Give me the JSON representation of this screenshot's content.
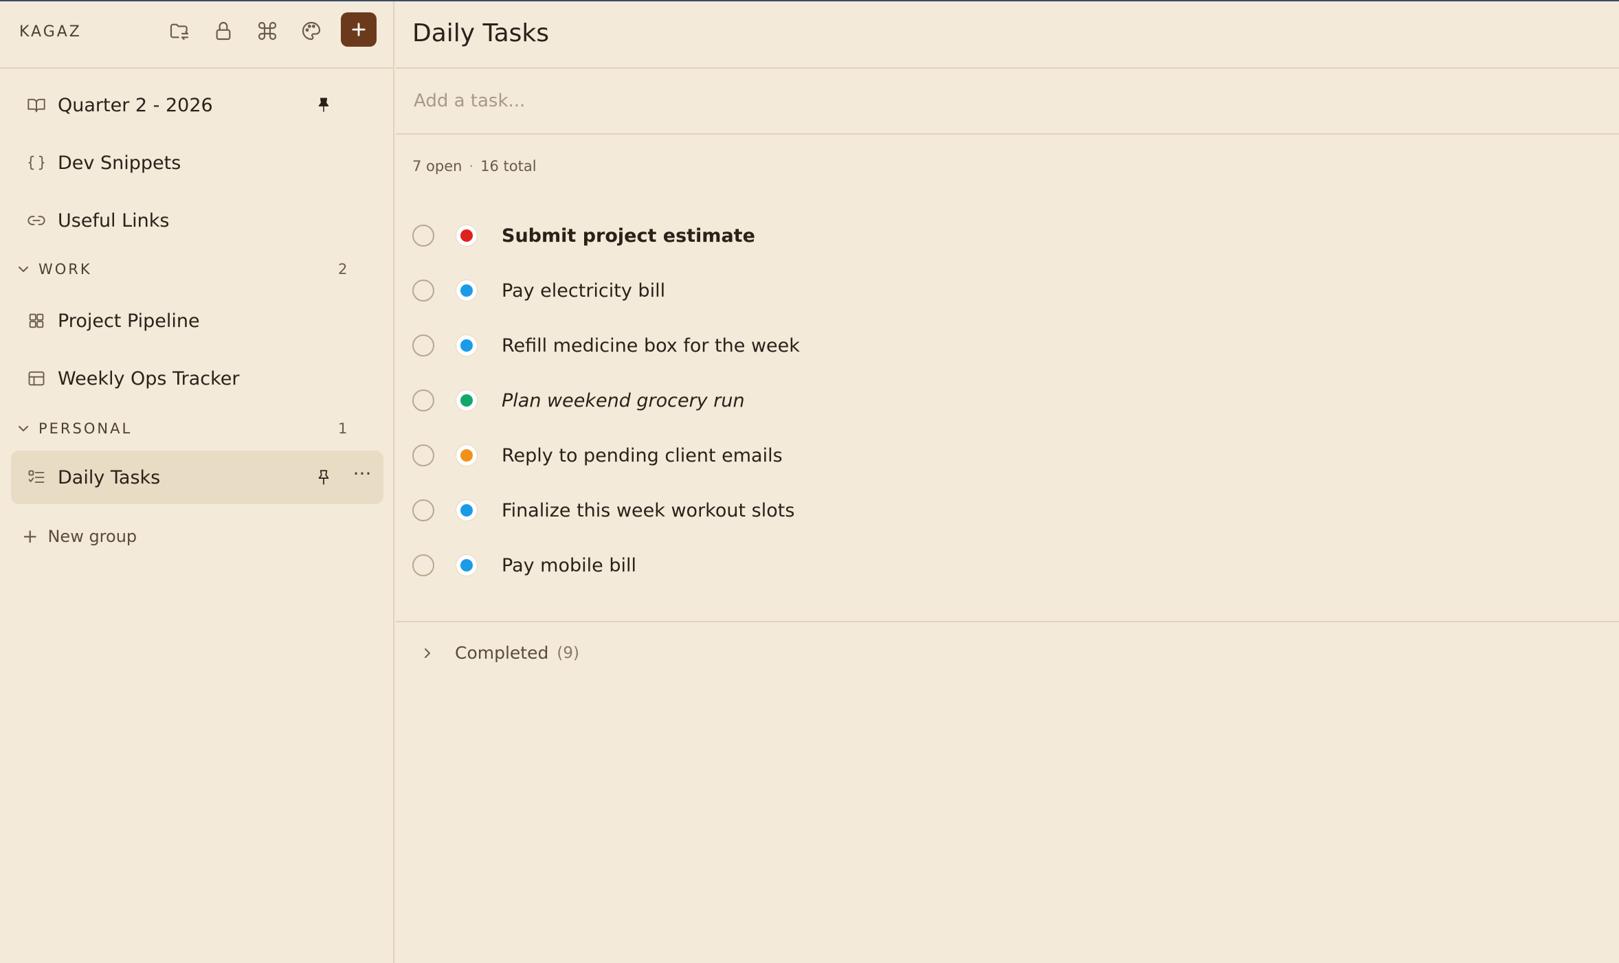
{
  "app": {
    "brand": "KAGAZ"
  },
  "header_icons": [
    "folder-sync-icon",
    "lock-icon",
    "command-icon",
    "palette-icon",
    "plus-icon"
  ],
  "sidebar": {
    "pinned": [
      {
        "label": "Quarter 2 - 2026",
        "icon": "book-icon",
        "pinned": true
      },
      {
        "label": "Dev Snippets",
        "icon": "braces-icon"
      },
      {
        "label": "Useful Links",
        "icon": "link-icon"
      }
    ],
    "groups": [
      {
        "name": "WORK",
        "count": "2",
        "items": [
          {
            "label": "Project Pipeline",
            "icon": "grid-icon"
          },
          {
            "label": "Weekly Ops Tracker",
            "icon": "table-icon"
          }
        ]
      },
      {
        "name": "PERSONAL",
        "count": "1",
        "items": [
          {
            "label": "Daily Tasks",
            "icon": "checklist-icon",
            "active": true
          }
        ]
      }
    ],
    "new_group_label": "New group"
  },
  "main": {
    "title": "Daily Tasks",
    "add_task_placeholder": "Add a task...",
    "open_count": "7 open",
    "total_count": "16 total",
    "tasks": [
      {
        "text": "Submit project estimate",
        "priority_color": "#e0201e",
        "style": "bold"
      },
      {
        "text": "Pay electricity bill",
        "priority_color": "#1a9be8",
        "style": "normal"
      },
      {
        "text": "Refill medicine box for the week",
        "priority_color": "#1a9be8",
        "style": "normal"
      },
      {
        "text": "Plan weekend grocery run",
        "priority_color": "#12a86a",
        "style": "italic"
      },
      {
        "text": "Reply to pending client emails",
        "priority_color": "#f0921a",
        "style": "normal"
      },
      {
        "text": "Finalize this week workout slots",
        "priority_color": "#1a9be8",
        "style": "normal"
      },
      {
        "text": "Pay mobile bill",
        "priority_color": "#1a9be8",
        "style": "normal"
      }
    ],
    "completed_label": "Completed",
    "completed_count": "(9)"
  },
  "colors": {
    "background": "#f3eada",
    "accent": "#6b3a1c",
    "active_item": "#e9dcc4",
    "border": "#e2d2b8"
  }
}
